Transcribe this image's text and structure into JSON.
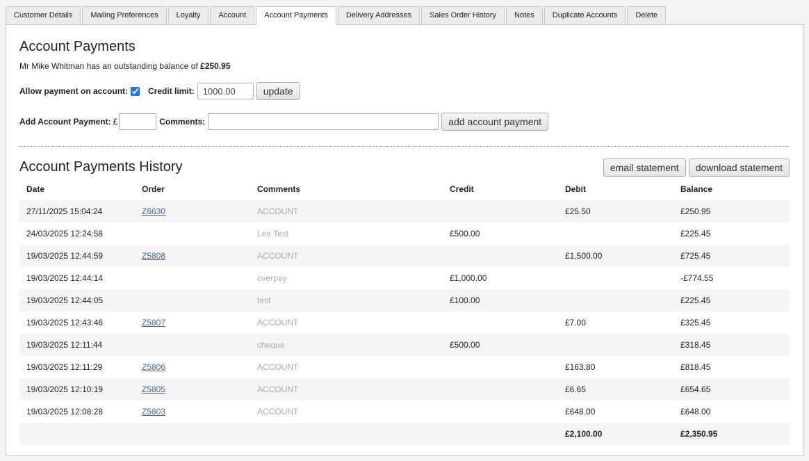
{
  "tabs": [
    {
      "label": "Customer Details"
    },
    {
      "label": "Mailing Preferences"
    },
    {
      "label": "Loyalty"
    },
    {
      "label": "Account"
    },
    {
      "label": "Account Payments"
    },
    {
      "label": "Delivery Addresses"
    },
    {
      "label": "Sales Order History"
    },
    {
      "label": "Notes"
    },
    {
      "label": "Duplicate Accounts"
    },
    {
      "label": "Delete"
    }
  ],
  "active_tab": "Account Payments",
  "page": {
    "title": "Account Payments",
    "balance_prefix": "Mr Mike Whitman has an outstanding balance of ",
    "balance_value": "£250.95"
  },
  "account_settings": {
    "allow_label": "Allow payment on account:",
    "allow_checked": true,
    "credit_label": "Credit limit:",
    "credit_value": "1000.00",
    "update_label": "update"
  },
  "add_payment": {
    "label": "Add Account Payment:",
    "currency": "£",
    "amount_value": "",
    "comments_label": "Comments:",
    "comments_value": "",
    "button_label": "add account payment"
  },
  "history": {
    "title": "Account Payments History",
    "email_label": "email statement",
    "download_label": "download statement",
    "columns": [
      "Date",
      "Order",
      "Comments",
      "Credit",
      "Debit",
      "Balance"
    ],
    "rows": [
      {
        "date": "27/11/2025 15:04:24",
        "order": "Z6630",
        "comments": "ACCOUNT",
        "credit": "",
        "debit": "£25.50",
        "balance": "£250.95"
      },
      {
        "date": "24/03/2025 12:24:58",
        "order": "",
        "comments": "Lee Test",
        "credit": "£500.00",
        "debit": "",
        "balance": "£225.45"
      },
      {
        "date": "19/03/2025 12:44:59",
        "order": "Z5808",
        "comments": "ACCOUNT",
        "credit": "",
        "debit": "£1,500.00",
        "balance": "£725.45"
      },
      {
        "date": "19/03/2025 12:44:14",
        "order": "",
        "comments": "overpay",
        "credit": "£1,000.00",
        "debit": "",
        "balance": "-£774.55"
      },
      {
        "date": "19/03/2025 12:44:05",
        "order": "",
        "comments": "test",
        "credit": "£100.00",
        "debit": "",
        "balance": "£225.45"
      },
      {
        "date": "19/03/2025 12:43:46",
        "order": "Z5807",
        "comments": "ACCOUNT",
        "credit": "",
        "debit": "£7.00",
        "balance": "£325.45"
      },
      {
        "date": "19/03/2025 12:11:44",
        "order": "",
        "comments": "cheque",
        "credit": "£500.00",
        "debit": "",
        "balance": "£318.45"
      },
      {
        "date": "19/03/2025 12:11:29",
        "order": "Z5806",
        "comments": "ACCOUNT",
        "credit": "",
        "debit": "£163.80",
        "balance": "£818.45"
      },
      {
        "date": "19/03/2025 12:10:19",
        "order": "Z5805",
        "comments": "ACCOUNT",
        "credit": "",
        "debit": "£6.65",
        "balance": "£654.65"
      },
      {
        "date": "19/03/2025 12:08:28",
        "order": "Z5803",
        "comments": "ACCOUNT",
        "credit": "",
        "debit": "£648.00",
        "balance": "£648.00"
      }
    ],
    "totals": {
      "debit": "£2,100.00",
      "balance": "£2,350.95"
    }
  }
}
